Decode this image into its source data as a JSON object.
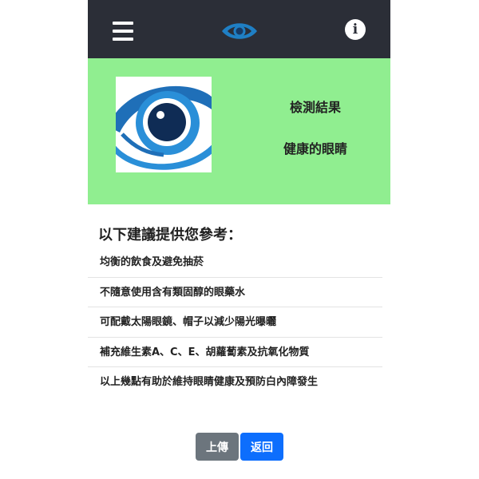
{
  "navbar": {
    "menu_icon": "hamburger-menu-icon",
    "logo_icon": "eye-logo-icon",
    "info_icon": "info-icon",
    "info_glyph": "i",
    "background": "#2b2e37"
  },
  "result": {
    "title": "檢測結果",
    "value": "健康的眼睛",
    "background": "#90ee90",
    "image_icon": "eye-image"
  },
  "advice": {
    "heading": "以下建議提供您參考：",
    "items": [
      "均衡的飲食及避免抽菸",
      "不隨意使用含有類固醇的眼藥水",
      "可配戴太陽眼鏡、帽子以減少陽光曝曬",
      "補充維生素A、C、E、胡蘿蔔素及抗氧化物質",
      "以上幾點有助於維持眼睛健康及預防白內障發生"
    ]
  },
  "buttons": {
    "upload_label": "上傳",
    "back_label": "返回",
    "upload_color": "#6c757d",
    "back_color": "#0d6efd"
  }
}
